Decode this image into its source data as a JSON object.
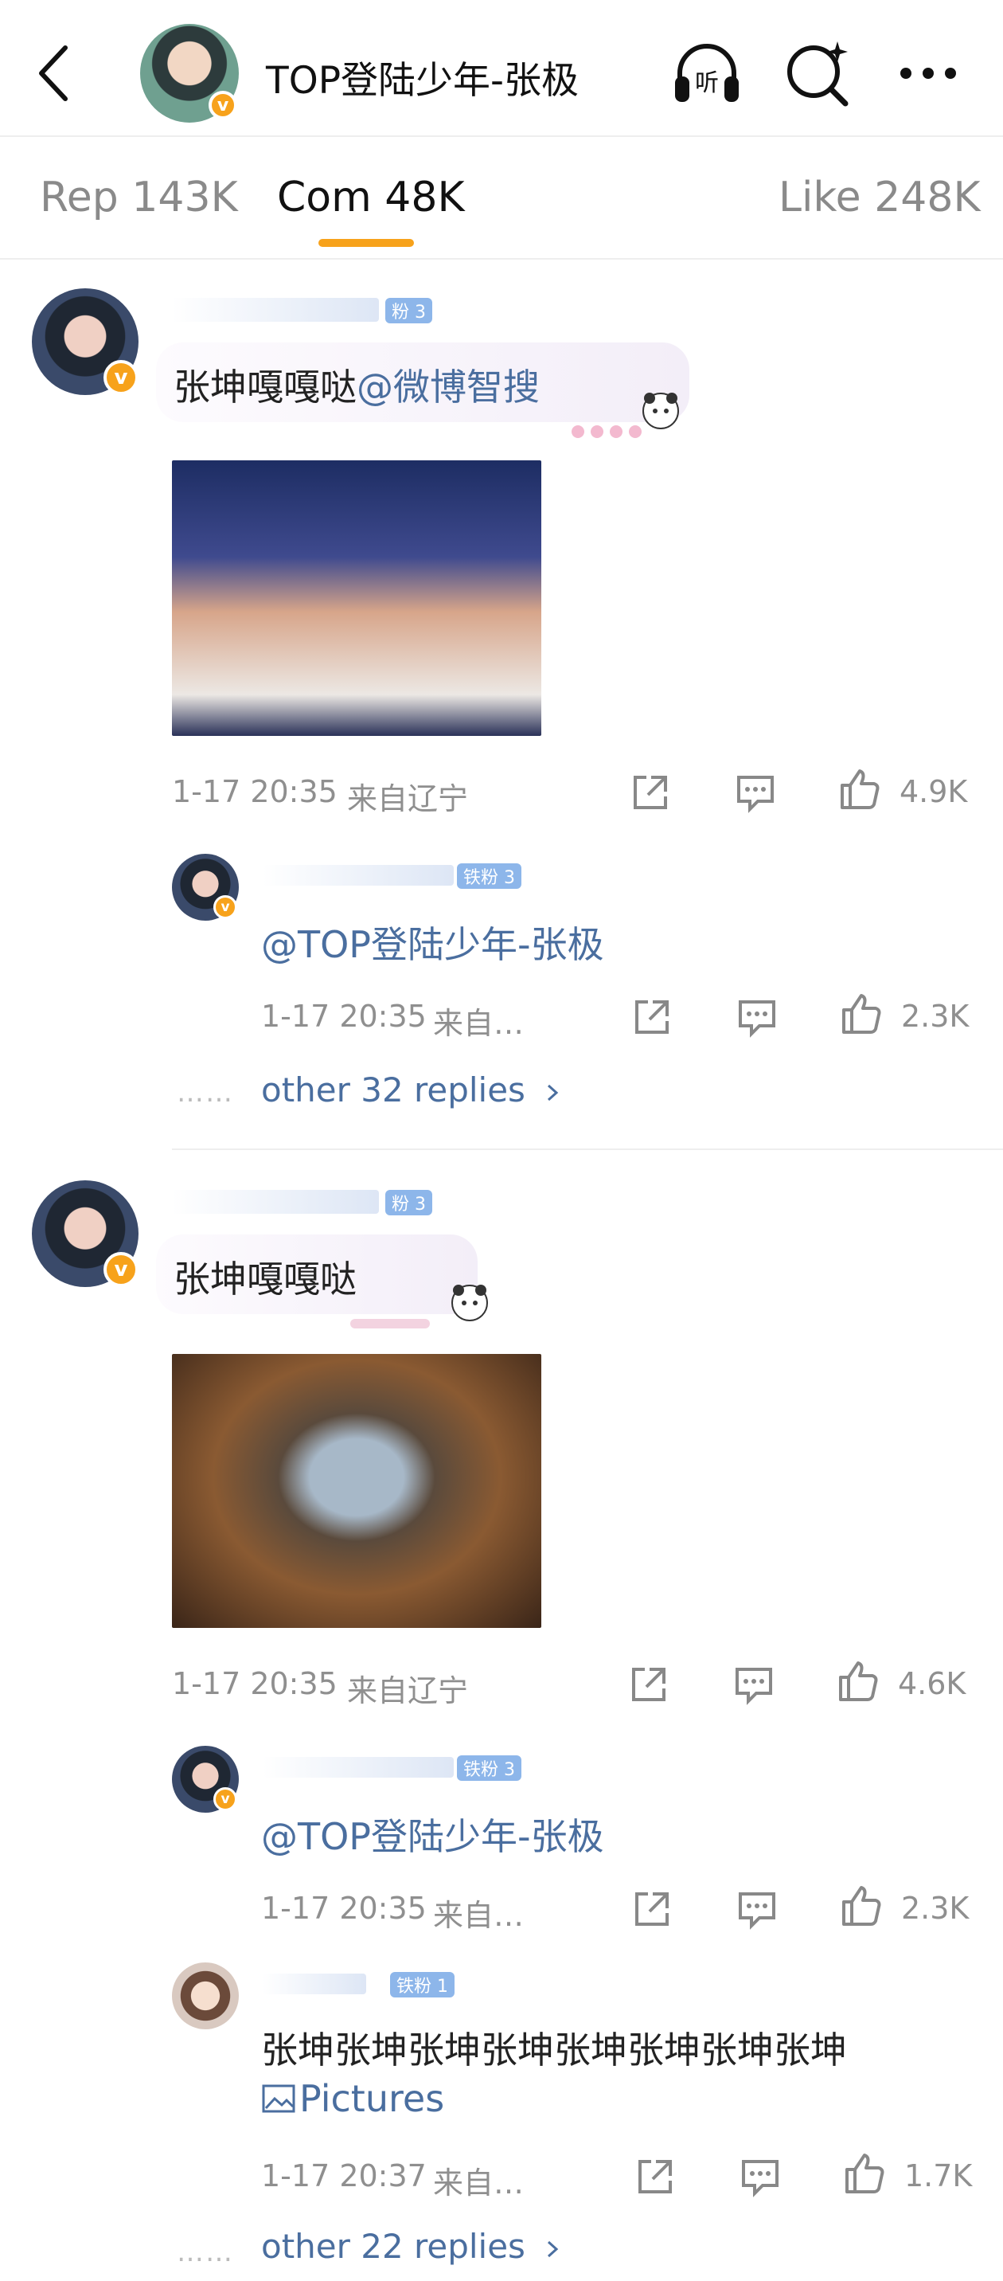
{
  "header": {
    "title": "TOP登陆少年-张极",
    "verified_mark": "v"
  },
  "tabs": [
    {
      "label": "Rep 143K"
    },
    {
      "label": "Com 48K"
    },
    {
      "label": "Like 248K"
    }
  ],
  "comments": [
    {
      "fan_badge": "粉 3",
      "text": "张坤嘎嘎哒",
      "mention": "@微博智搜",
      "time": "1-17 20:35",
      "location": "来自辽宁",
      "likes": "4.9K",
      "replies": [
        {
          "fan_badge": "铁粉 3",
          "text": "@TOP登陆少年-张极",
          "time": "1-17 20:35",
          "location": "来自…",
          "likes": "2.3K"
        }
      ],
      "more_dots": "……",
      "more_replies": "other 32 replies"
    },
    {
      "fan_badge": "粉 3",
      "text": "张坤嘎嘎哒",
      "time": "1-17 20:35",
      "location": "来自辽宁",
      "likes": "4.6K",
      "replies": [
        {
          "fan_badge": "铁粉 3",
          "text": "@TOP登陆少年-张极",
          "time": "1-17 20:35",
          "location": "来自…",
          "likes": "2.3K"
        },
        {
          "fan_badge": "铁粉 1",
          "text": "张坤张坤张坤张坤张坤张坤张坤张坤",
          "pictures_label": "Pictures",
          "time": "1-17 20:37",
          "location": "来自…",
          "likes": "1.7K"
        }
      ],
      "more_dots": "……",
      "more_replies": "other 22 replies"
    }
  ],
  "icons": {
    "back": "back-arrow-icon",
    "listen": "headphones-icon",
    "search": "search-sparkle-icon",
    "more": "more-dots-icon",
    "share": "share-icon",
    "comment": "comment-icon",
    "like": "thumbs-up-icon",
    "chevron": "chevron-right-icon",
    "picture": "picture-icon"
  },
  "colors": {
    "accent": "#f7a21b",
    "link": "#4a6e9f",
    "meta": "#8f8f8f"
  }
}
